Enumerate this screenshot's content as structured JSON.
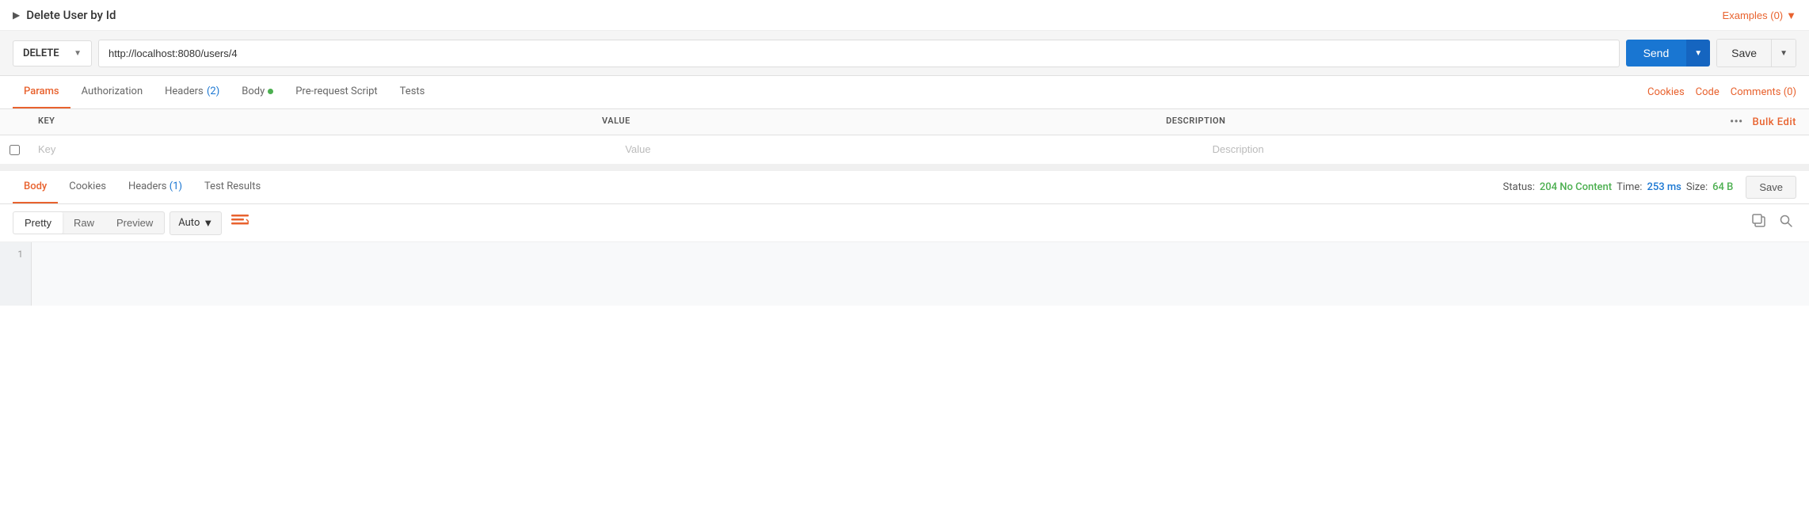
{
  "title": {
    "arrow": "▶",
    "text": "Delete User by Id",
    "examples_label": "Examples (0)",
    "examples_chevron": "▼"
  },
  "url_bar": {
    "method": "DELETE",
    "method_chevron": "▼",
    "url": "http://localhost:8080/users/4",
    "send_label": "Send",
    "send_chevron": "▼",
    "save_label": "Save",
    "save_chevron": "▼"
  },
  "request_tabs": {
    "items": [
      {
        "label": "Params",
        "active": true,
        "badge": "",
        "dot": false
      },
      {
        "label": "Authorization",
        "active": false,
        "badge": "",
        "dot": false
      },
      {
        "label": "Headers",
        "active": false,
        "badge": " (2)",
        "dot": false
      },
      {
        "label": "Body",
        "active": false,
        "badge": "",
        "dot": true
      },
      {
        "label": "Pre-request Script",
        "active": false,
        "badge": "",
        "dot": false
      },
      {
        "label": "Tests",
        "active": false,
        "badge": "",
        "dot": false
      }
    ],
    "right_links": [
      "Cookies",
      "Code",
      "Comments (0)"
    ]
  },
  "params_table": {
    "columns": [
      "KEY",
      "VALUE",
      "DESCRIPTION"
    ],
    "bulk_edit_label": "Bulk Edit",
    "more_icon": "•••",
    "rows": [
      {
        "key_placeholder": "Key",
        "value_placeholder": "Value",
        "desc_placeholder": "Description"
      }
    ]
  },
  "response_tabs": {
    "items": [
      {
        "label": "Body",
        "active": true,
        "badge": ""
      },
      {
        "label": "Cookies",
        "active": false,
        "badge": ""
      },
      {
        "label": "Headers",
        "active": false,
        "badge": " (1)"
      },
      {
        "label": "Test Results",
        "active": false,
        "badge": ""
      }
    ],
    "status_label": "Status:",
    "status_value": "204 No Content",
    "time_label": "Time:",
    "time_value": "253 ms",
    "size_label": "Size:",
    "size_value": "64 B",
    "save_label": "Save"
  },
  "body_toolbar": {
    "views": [
      "Pretty",
      "Raw",
      "Preview"
    ],
    "active_view": "Pretty",
    "format": "Auto",
    "format_chevron": "▼",
    "wrap_icon": "≡",
    "copy_icon": "⧉",
    "search_icon": "🔍"
  },
  "code_area": {
    "line_numbers": [
      "1"
    ],
    "content": ""
  }
}
